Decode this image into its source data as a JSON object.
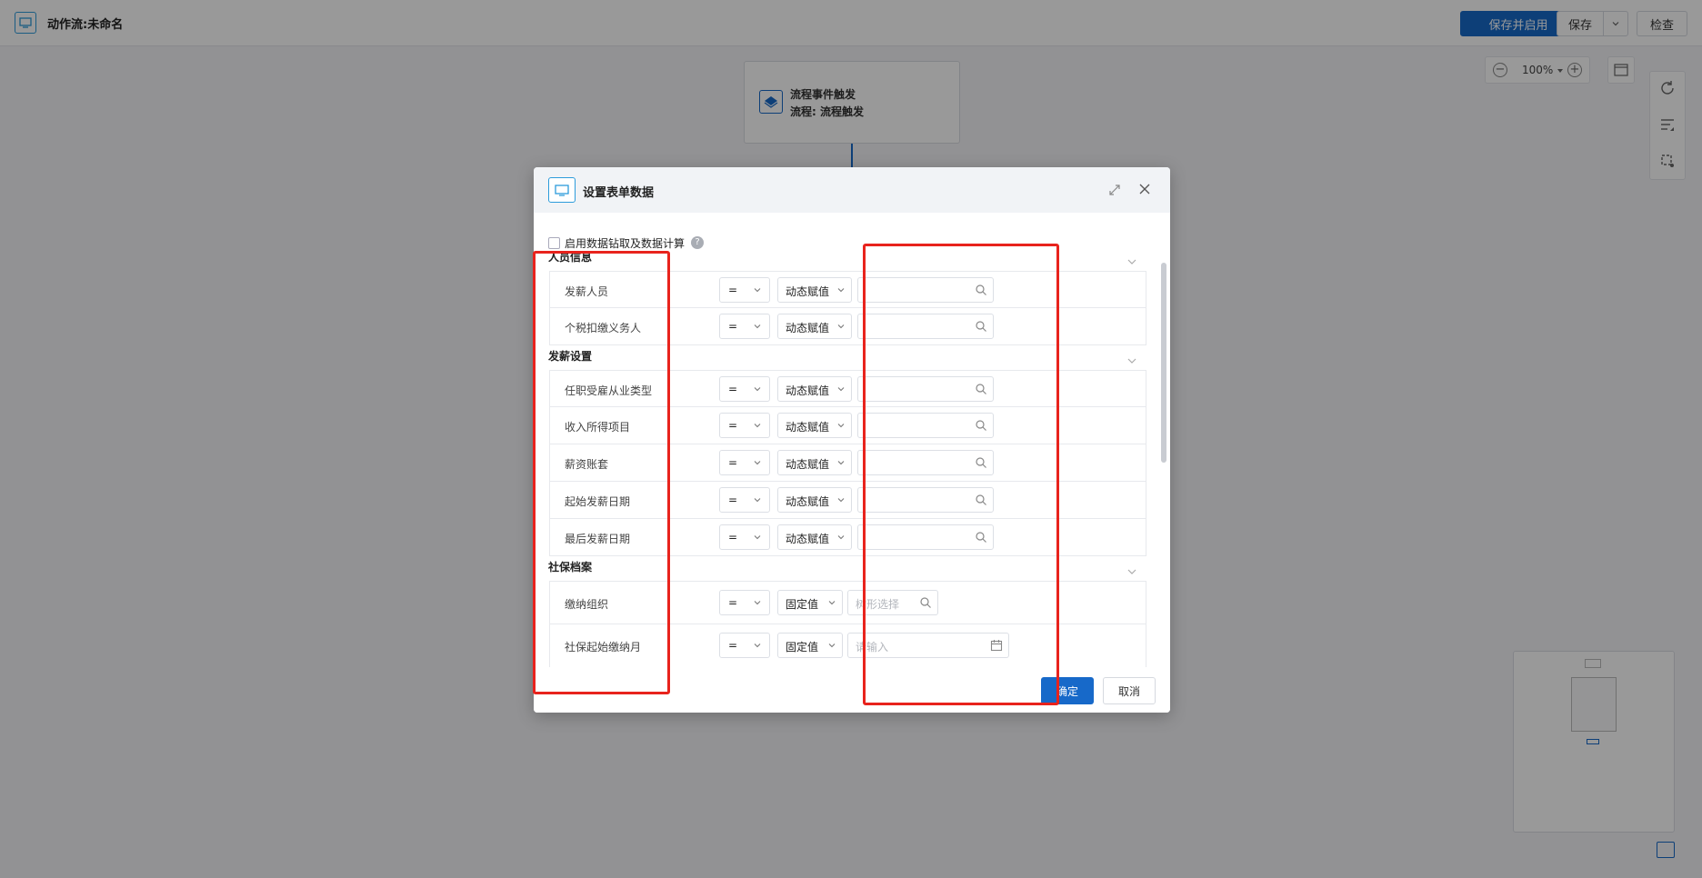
{
  "app": {
    "title": "动作流:未命名",
    "buttons": {
      "save_enable": "保存并启用",
      "save": "保存",
      "check": "检查"
    }
  },
  "canvas": {
    "zoom": "100%",
    "node": {
      "line1": "流程事件触发",
      "line2": "流程: 流程触发"
    }
  },
  "dialog": {
    "title": "设置表单数据",
    "enable_label": "启用数据钻取及数据计算",
    "help": "?",
    "sections": [
      {
        "title": "人员信息",
        "fields": [
          {
            "label": "发薪人员",
            "op": "=",
            "type": "动态赋值",
            "placeholder": "",
            "icon": "search-icon"
          },
          {
            "label": "个税扣缴义务人",
            "op": "=",
            "type": "动态赋值",
            "placeholder": "",
            "icon": "search-icon"
          }
        ]
      },
      {
        "title": "发薪设置",
        "fields": [
          {
            "label": "任职受雇从业类型",
            "op": "=",
            "type": "动态赋值",
            "placeholder": "",
            "icon": "search-icon"
          },
          {
            "label": "收入所得项目",
            "op": "=",
            "type": "动态赋值",
            "placeholder": "",
            "icon": "search-icon"
          },
          {
            "label": "薪资账套",
            "op": "=",
            "type": "动态赋值",
            "placeholder": "",
            "icon": "search-icon"
          },
          {
            "label": "起始发薪日期",
            "op": "=",
            "type": "动态赋值",
            "placeholder": "",
            "icon": "search-icon"
          },
          {
            "label": "最后发薪日期",
            "op": "=",
            "type": "动态赋值",
            "placeholder": "",
            "icon": "search-icon"
          }
        ]
      },
      {
        "title": "社保档案",
        "fields": [
          {
            "label": "缴纳组织",
            "op": "=",
            "type": "固定值",
            "placeholder": "树形选择",
            "icon": "search-icon"
          },
          {
            "label": "社保起始缴纳月",
            "op": "=",
            "type": "固定值",
            "placeholder": "请输入",
            "icon": "calendar-icon"
          }
        ]
      }
    ],
    "footer": {
      "ok": "确定",
      "cancel": "取消"
    }
  },
  "colors": {
    "primary": "#1769c9",
    "annotation": "#e8231d",
    "icon_accent": "#2d9cdb"
  }
}
